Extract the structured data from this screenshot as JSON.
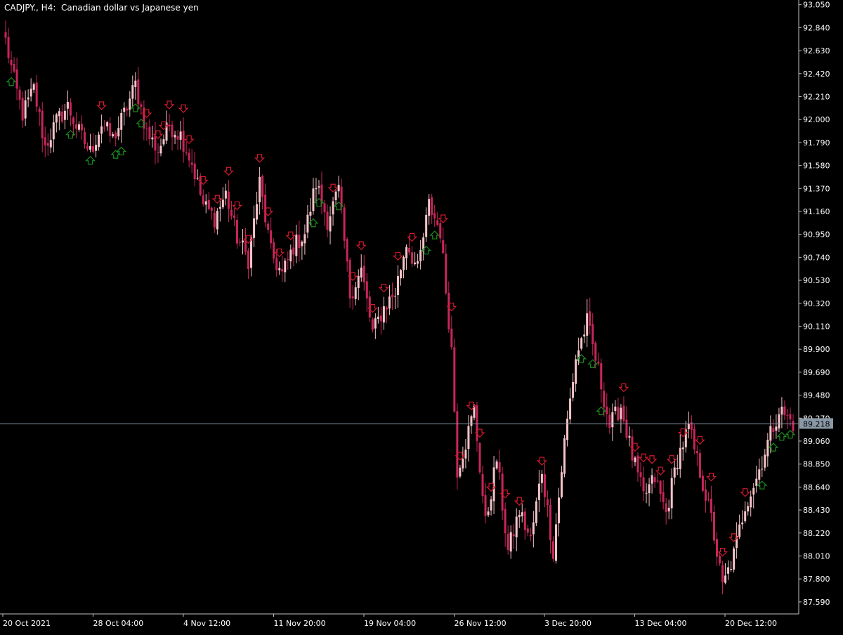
{
  "header": {
    "symbol_label": "CADJPY., H4:  Canadian dollar vs Japanese yen"
  },
  "colors": {
    "background": "#000000",
    "axis": "#c0c0c0",
    "text": "#ffffff",
    "candle_up": "#f5c3c8",
    "candle_down": "#c8265a",
    "candle_neutral_up": "#6dd96d",
    "arrow_down": "#d31a2b",
    "arrow_up": "#1a8c1a",
    "price_line": "#8a99a6",
    "price_tag_bg": "#8a99a6",
    "price_tag_text": "#000000"
  },
  "chart_data": {
    "type": "candlestick",
    "ylim": [
      87.48,
      93.08
    ],
    "y_ticks": [
      "93.050",
      "92.840",
      "92.630",
      "92.420",
      "92.210",
      "92.000",
      "91.790",
      "91.580",
      "91.370",
      "91.160",
      "90.950",
      "90.740",
      "90.530",
      "90.320",
      "90.110",
      "89.900",
      "89.690",
      "89.480",
      "89.270",
      "89.060",
      "88.850",
      "88.640",
      "88.430",
      "88.220",
      "88.010",
      "87.800",
      "87.590"
    ],
    "x_ticks": [
      "20 Oct 2021",
      "28 Oct 04:00",
      "4 Nov 12:00",
      "11 Nov 20:00",
      "19 Nov 04:00",
      "26 Nov 12:00",
      "3 Dec 20:00",
      "13 Dec 04:00",
      "20 Dec 12:00"
    ],
    "current_price": 89.218,
    "current_price_label": "89.218",
    "bar_count": 280,
    "anchors": [
      [
        0,
        92.72
      ],
      [
        3,
        92.35
      ],
      [
        6,
        92.05
      ],
      [
        10,
        92.28
      ],
      [
        14,
        91.75
      ],
      [
        18,
        91.98
      ],
      [
        22,
        92.12
      ],
      [
        26,
        91.88
      ],
      [
        30,
        91.7
      ],
      [
        34,
        91.96
      ],
      [
        38,
        91.82
      ],
      [
        42,
        92.05
      ],
      [
        46,
        92.32
      ],
      [
        50,
        91.88
      ],
      [
        54,
        91.72
      ],
      [
        58,
        91.95
      ],
      [
        62,
        91.86
      ],
      [
        66,
        91.6
      ],
      [
        70,
        91.22
      ],
      [
        74,
        91.1
      ],
      [
        78,
        91.32
      ],
      [
        82,
        90.92
      ],
      [
        86,
        90.72
      ],
      [
        90,
        91.42
      ],
      [
        94,
        90.78
      ],
      [
        98,
        90.58
      ],
      [
        102,
        90.84
      ],
      [
        106,
        90.96
      ],
      [
        110,
        91.42
      ],
      [
        114,
        91.08
      ],
      [
        118,
        91.35
      ],
      [
        122,
        90.4
      ],
      [
        126,
        90.62
      ],
      [
        130,
        90.05
      ],
      [
        134,
        90.28
      ],
      [
        138,
        90.42
      ],
      [
        142,
        90.88
      ],
      [
        146,
        90.62
      ],
      [
        150,
        91.22
      ],
      [
        154,
        90.98
      ],
      [
        158,
        89.9
      ],
      [
        160,
        88.8
      ],
      [
        163,
        89.05
      ],
      [
        166,
        89.35
      ],
      [
        170,
        88.3
      ],
      [
        174,
        88.9
      ],
      [
        178,
        88.05
      ],
      [
        182,
        88.42
      ],
      [
        186,
        88.15
      ],
      [
        190,
        88.8
      ],
      [
        194,
        88.05
      ],
      [
        198,
        89.05
      ],
      [
        202,
        89.82
      ],
      [
        206,
        90.15
      ],
      [
        210,
        89.7
      ],
      [
        214,
        89.2
      ],
      [
        218,
        89.38
      ],
      [
        222,
        88.92
      ],
      [
        226,
        88.55
      ],
      [
        230,
        88.72
      ],
      [
        234,
        88.4
      ],
      [
        238,
        88.9
      ],
      [
        242,
        89.18
      ],
      [
        246,
        88.78
      ],
      [
        250,
        88.35
      ],
      [
        254,
        87.72
      ],
      [
        258,
        88.02
      ],
      [
        262,
        88.48
      ],
      [
        266,
        88.72
      ],
      [
        270,
        89.05
      ],
      [
        274,
        89.35
      ],
      [
        279,
        89.22
      ]
    ],
    "arrows": [
      {
        "bar": 2,
        "dir": "up"
      },
      {
        "bar": 23,
        "dir": "up"
      },
      {
        "bar": 34,
        "dir": "down"
      },
      {
        "bar": 30,
        "dir": "up"
      },
      {
        "bar": 39,
        "dir": "up"
      },
      {
        "bar": 41,
        "dir": "up"
      },
      {
        "bar": 46,
        "dir": "up"
      },
      {
        "bar": 48,
        "dir": "up"
      },
      {
        "bar": 50,
        "dir": "down"
      },
      {
        "bar": 54,
        "dir": "down"
      },
      {
        "bar": 56,
        "dir": "down"
      },
      {
        "bar": 58,
        "dir": "down"
      },
      {
        "bar": 63,
        "dir": "down"
      },
      {
        "bar": 65,
        "dir": "down"
      },
      {
        "bar": 70,
        "dir": "down"
      },
      {
        "bar": 75,
        "dir": "down"
      },
      {
        "bar": 79,
        "dir": "down"
      },
      {
        "bar": 82,
        "dir": "down"
      },
      {
        "bar": 86,
        "dir": "down"
      },
      {
        "bar": 90,
        "dir": "down"
      },
      {
        "bar": 93,
        "dir": "down"
      },
      {
        "bar": 97,
        "dir": "down"
      },
      {
        "bar": 101,
        "dir": "down"
      },
      {
        "bar": 109,
        "dir": "up"
      },
      {
        "bar": 111,
        "dir": "up"
      },
      {
        "bar": 116,
        "dir": "down"
      },
      {
        "bar": 118,
        "dir": "up"
      },
      {
        "bar": 123,
        "dir": "down"
      },
      {
        "bar": 126,
        "dir": "down"
      },
      {
        "bar": 130,
        "dir": "down"
      },
      {
        "bar": 134,
        "dir": "down"
      },
      {
        "bar": 139,
        "dir": "down"
      },
      {
        "bar": 144,
        "dir": "down"
      },
      {
        "bar": 149,
        "dir": "up"
      },
      {
        "bar": 152,
        "dir": "up"
      },
      {
        "bar": 155,
        "dir": "down"
      },
      {
        "bar": 158,
        "dir": "down"
      },
      {
        "bar": 161,
        "dir": "down"
      },
      {
        "bar": 165,
        "dir": "down"
      },
      {
        "bar": 168,
        "dir": "down"
      },
      {
        "bar": 172,
        "dir": "down"
      },
      {
        "bar": 177,
        "dir": "down"
      },
      {
        "bar": 182,
        "dir": "down"
      },
      {
        "bar": 190,
        "dir": "down"
      },
      {
        "bar": 204,
        "dir": "up"
      },
      {
        "bar": 208,
        "dir": "up"
      },
      {
        "bar": 211,
        "dir": "up"
      },
      {
        "bar": 219,
        "dir": "down"
      },
      {
        "bar": 223,
        "dir": "down"
      },
      {
        "bar": 226,
        "dir": "down"
      },
      {
        "bar": 229,
        "dir": "down"
      },
      {
        "bar": 232,
        "dir": "down"
      },
      {
        "bar": 236,
        "dir": "down"
      },
      {
        "bar": 240,
        "dir": "down"
      },
      {
        "bar": 246,
        "dir": "down"
      },
      {
        "bar": 250,
        "dir": "down"
      },
      {
        "bar": 254,
        "dir": "down"
      },
      {
        "bar": 258,
        "dir": "down"
      },
      {
        "bar": 262,
        "dir": "down"
      },
      {
        "bar": 268,
        "dir": "up"
      },
      {
        "bar": 272,
        "dir": "up"
      },
      {
        "bar": 275,
        "dir": "up"
      },
      {
        "bar": 278,
        "dir": "up"
      }
    ]
  }
}
